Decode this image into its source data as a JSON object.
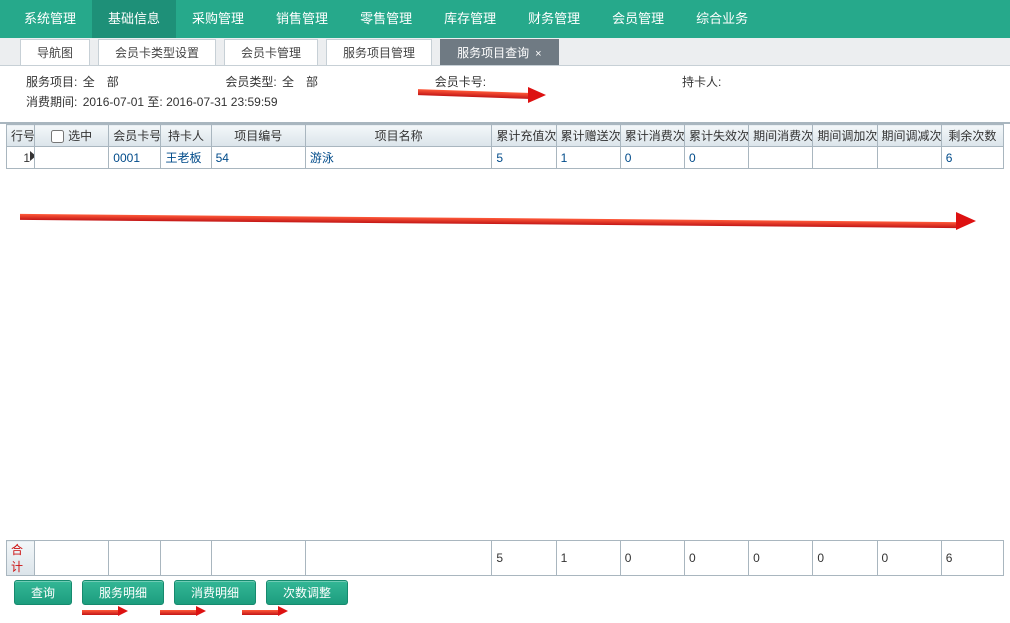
{
  "topmenu": [
    "系统管理",
    "基础信息",
    "采购管理",
    "销售管理",
    "零售管理",
    "库存管理",
    "财务管理",
    "会员管理",
    "综合业务"
  ],
  "topmenu_active_index": 1,
  "tabs": [
    {
      "label": "导航图",
      "closable": false
    },
    {
      "label": "会员卡类型设置",
      "closable": false
    },
    {
      "label": "会员卡管理",
      "closable": false
    },
    {
      "label": "服务项目管理",
      "closable": false
    },
    {
      "label": "服务项目查询",
      "closable": true,
      "active": true
    }
  ],
  "filter": {
    "service_item_label": "服务项目:",
    "service_item_value": "全　部",
    "member_type_label": "会员类型:",
    "member_type_value": "全　部",
    "card_no_label": "会员卡号:",
    "card_no_value": "",
    "holder_label": "持卡人:",
    "holder_value": "",
    "period_label": "消费期间:",
    "period_value": "2016-07-01  至: 2016-07-31 23:59:59"
  },
  "columns": [
    "行号",
    "选中",
    "会员卡号",
    "持卡人",
    "项目编号",
    "项目名称",
    "累计充值次",
    "累计赠送次",
    "累计消费次",
    "累计失效次",
    "期间消费次",
    "期间调加次",
    "期间调减次",
    "剩余次数"
  ],
  "rows": [
    {
      "rownum": "1",
      "checked": false,
      "card_no": "0001",
      "holder": "王老板",
      "item_no": "54",
      "item_name": "游泳",
      "n_charge": "5",
      "n_gift": "1",
      "n_consume": "0",
      "n_expire": "0",
      "n_period_consume": "",
      "n_period_add": "",
      "n_period_sub": "",
      "n_remain": "6"
    }
  ],
  "totals": {
    "label": "合计",
    "n_charge": "5",
    "n_gift": "1",
    "n_consume": "0",
    "n_expire": "0",
    "n_period_consume": "0",
    "n_period_add": "0",
    "n_period_sub": "0",
    "n_remain": "6"
  },
  "buttons": {
    "query": "查询",
    "service_detail": "服务明细",
    "consume_detail": "消费明细",
    "count_adjust": "次数调整"
  }
}
